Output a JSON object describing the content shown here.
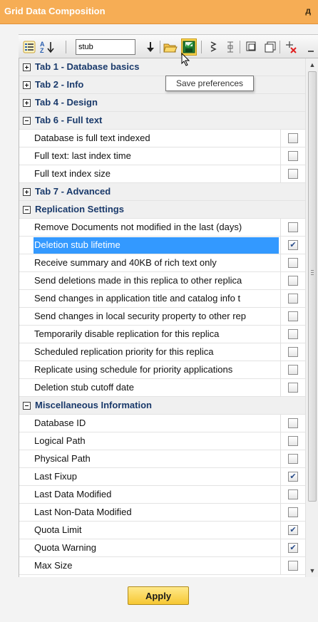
{
  "panel": {
    "title": "Grid Data Composition",
    "pin_icon": "pin-icon",
    "pin_glyph": "д"
  },
  "toolbar": {
    "search_value": "stub",
    "sort_glyph": "A↓Z",
    "tooltip": "Save preferences"
  },
  "rows": [
    {
      "kind": "category",
      "label": "Tab 1 - Database basics",
      "expanded": false
    },
    {
      "kind": "category",
      "label": "Tab 2 - Info",
      "expanded": false
    },
    {
      "kind": "category",
      "label": "Tab 4 - Design",
      "expanded": false
    },
    {
      "kind": "category",
      "label": "Tab 6 - Full text",
      "expanded": true
    },
    {
      "kind": "item",
      "label": "Database is full text indexed",
      "checked": false
    },
    {
      "kind": "item",
      "label": "Full text: last index time",
      "checked": false
    },
    {
      "kind": "item",
      "label": "Full text index size",
      "checked": false
    },
    {
      "kind": "category",
      "label": "Tab 7 - Advanced",
      "expanded": false
    },
    {
      "kind": "category",
      "label": "Replication Settings",
      "expanded": true
    },
    {
      "kind": "item",
      "label": "Remove Documents not modified in the last (days)",
      "checked": false
    },
    {
      "kind": "item",
      "label": "Deletion stub lifetime",
      "checked": true,
      "selected": true
    },
    {
      "kind": "item",
      "label": "Receive summary and 40KB of rich text only",
      "checked": false
    },
    {
      "kind": "item",
      "label": "Send deletions made in this replica to other replica",
      "checked": false
    },
    {
      "kind": "item",
      "label": "Send changes in application title and catalog info t",
      "checked": false
    },
    {
      "kind": "item",
      "label": "Send changes in local security property to other rep",
      "checked": false
    },
    {
      "kind": "item",
      "label": "Temporarily disable replication for this replica",
      "checked": false
    },
    {
      "kind": "item",
      "label": "Scheduled replication priority for this replica",
      "checked": false
    },
    {
      "kind": "item",
      "label": "Replicate using schedule for priority applications",
      "checked": false
    },
    {
      "kind": "item",
      "label": "Deletion stub cutoff date",
      "checked": false
    },
    {
      "kind": "category",
      "label": "Miscellaneous Information",
      "expanded": true
    },
    {
      "kind": "item",
      "label": "Database ID",
      "checked": false
    },
    {
      "kind": "item",
      "label": "Logical Path",
      "checked": false
    },
    {
      "kind": "item",
      "label": "Physical Path",
      "checked": false
    },
    {
      "kind": "item",
      "label": "Last Fixup",
      "checked": true
    },
    {
      "kind": "item",
      "label": "Last Data Modified",
      "checked": false
    },
    {
      "kind": "item",
      "label": "Last Non-Data Modified",
      "checked": false
    },
    {
      "kind": "item",
      "label": "Quota Limit",
      "checked": true
    },
    {
      "kind": "item",
      "label": "Quota Warning",
      "checked": true
    },
    {
      "kind": "item",
      "label": "Max Size",
      "checked": false
    }
  ],
  "apply_label": "Apply",
  "colors": {
    "title_bar": "#f6ad55",
    "selection": "#3399ff",
    "apply_button": "#f6c733"
  }
}
